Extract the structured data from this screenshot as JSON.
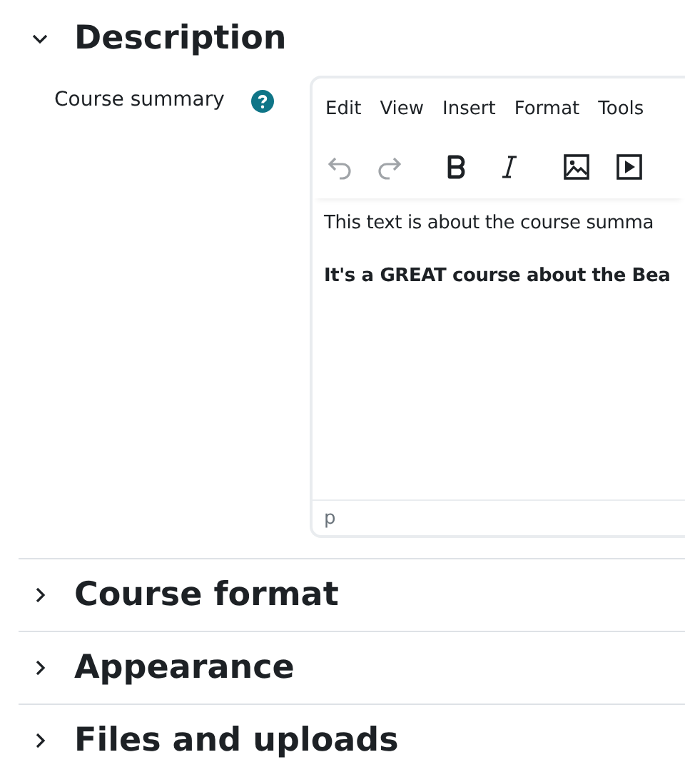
{
  "sections": [
    {
      "title": "Description",
      "expanded": true
    },
    {
      "title": "Course format",
      "expanded": false
    },
    {
      "title": "Appearance",
      "expanded": false
    },
    {
      "title": "Files and uploads",
      "expanded": false
    }
  ],
  "field": {
    "label": "Course summary"
  },
  "editor": {
    "menu": [
      "Edit",
      "View",
      "Insert",
      "Format",
      "Tools"
    ],
    "toolbar": [
      {
        "kind": "undo",
        "disabled": true
      },
      {
        "kind": "redo",
        "disabled": true
      },
      {
        "kind": "bold",
        "disabled": false
      },
      {
        "kind": "italic",
        "disabled": false
      },
      {
        "kind": "image",
        "disabled": false
      },
      {
        "kind": "media",
        "disabled": false
      }
    ],
    "paragraphs": [
      {
        "text": "This text is about the course summa",
        "bold": false
      },
      {
        "text": "It's a GREAT course about the Bea",
        "bold": true
      }
    ],
    "status_path": "p"
  }
}
